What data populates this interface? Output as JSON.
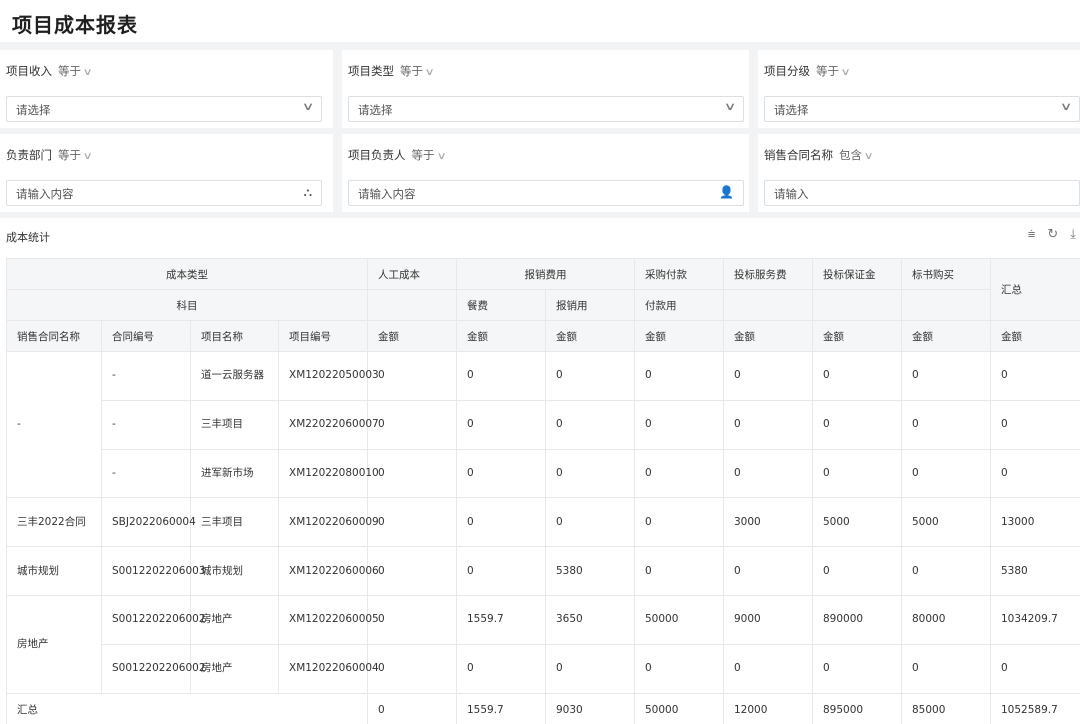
{
  "page_title": "项目成本报表",
  "filters": [
    {
      "label": "项目收入",
      "op": "等于",
      "placeholder": "请选择",
      "icon": "chevron-down-icon"
    },
    {
      "label": "项目类型",
      "op": "等于",
      "placeholder": "请选择",
      "icon": "chevron-down-icon"
    },
    {
      "label": "项目分级",
      "op": "等于",
      "placeholder": "请选择",
      "icon": "chevron-down-icon"
    },
    {
      "label": "负责部门",
      "op": "等于",
      "placeholder": "请输入内容",
      "icon": "org-tree-icon"
    },
    {
      "label": "项目负责人",
      "op": "等于",
      "placeholder": "请输入内容",
      "icon": "user-icon"
    },
    {
      "label": "销售合同名称",
      "op": "包含",
      "placeholder": "请输入",
      "icon": ""
    }
  ],
  "section_title": "成本统计",
  "toolbar_icons": [
    "filter-icon",
    "refresh-icon",
    "download-icon"
  ],
  "table": {
    "header_row1": {
      "cost_type": "成本类型",
      "labor": "人工成本",
      "reimburse": "报销费用",
      "purchase": "采购付款",
      "bid_service": "投标服务费",
      "bid_deposit": "投标保证金",
      "tender_buy": "标书购买",
      "total": "汇总"
    },
    "header_row2": {
      "subject": "科目",
      "meal": "餐费",
      "reimburse_use": "报销用",
      "pay_use": "付款用"
    },
    "header_row3": [
      "销售合同名称",
      "合同编号",
      "项目名称",
      "项目编号",
      "金额",
      "金额",
      "金额",
      "金额",
      "金额",
      "金额",
      "金额",
      "金额"
    ],
    "groups": [
      {
        "contract_name": "-",
        "rows": [
          {
            "contract_no": "-",
            "project_name": "道一云服务器",
            "project_no": "XM12022050003",
            "values": [
              "0",
              "0",
              "0",
              "0",
              "0",
              "0",
              "0",
              "0"
            ]
          },
          {
            "contract_no": "-",
            "project_name": "三丰项目",
            "project_no": "XM22022060007",
            "values": [
              "0",
              "0",
              "0",
              "0",
              "0",
              "0",
              "0",
              "0"
            ]
          },
          {
            "contract_no": "-",
            "project_name": "进军新市场",
            "project_no": "XM12022080010",
            "values": [
              "0",
              "0",
              "0",
              "0",
              "0",
              "0",
              "0",
              "0"
            ]
          }
        ]
      },
      {
        "contract_name": "三丰2022合同",
        "rows": [
          {
            "contract_no": "SBJ2022060004",
            "project_name": "三丰项目",
            "project_no": "XM12022060009",
            "values": [
              "0",
              "0",
              "0",
              "0",
              "3000",
              "5000",
              "5000",
              "13000"
            ]
          }
        ]
      },
      {
        "contract_name": "城市规划",
        "rows": [
          {
            "contract_no": "S0012202206003",
            "project_name": "城市规划",
            "project_no": "XM12022060006",
            "values": [
              "0",
              "0",
              "5380",
              "0",
              "0",
              "0",
              "0",
              "5380"
            ]
          }
        ]
      },
      {
        "contract_name": "房地产",
        "rows": [
          {
            "contract_no": "S0012202206002",
            "project_name": "房地产",
            "project_no": "XM12022060005",
            "values": [
              "0",
              "1559.7",
              "3650",
              "50000",
              "9000",
              "890000",
              "80000",
              "1034209.7"
            ]
          },
          {
            "contract_no": "S0012202206002",
            "project_name": "房地产",
            "project_no": "XM12022060004",
            "values": [
              "0",
              "0",
              "0",
              "0",
              "0",
              "0",
              "0",
              "0"
            ]
          }
        ]
      }
    ],
    "total_row": {
      "label": "汇总",
      "values": [
        "0",
        "1559.7",
        "9030",
        "50000",
        "12000",
        "895000",
        "85000",
        "1052589.7"
      ]
    }
  }
}
